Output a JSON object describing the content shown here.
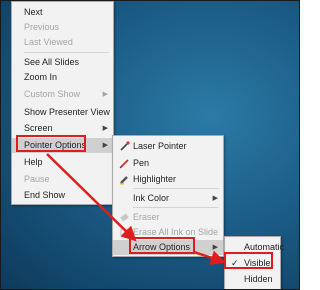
{
  "main_menu": {
    "items": [
      {
        "label": "Next"
      },
      {
        "label": "Previous"
      },
      {
        "label": "Last Viewed"
      },
      {
        "label": "See All Slides"
      },
      {
        "label": "Zoom In"
      },
      {
        "label": "Custom Show"
      },
      {
        "label": "Show Presenter View"
      },
      {
        "label": "Screen"
      },
      {
        "label": "Pointer Options"
      },
      {
        "label": "Help"
      },
      {
        "label": "Pause"
      },
      {
        "label": "End Show"
      }
    ]
  },
  "pointer_menu": {
    "items": [
      {
        "label": "Laser Pointer"
      },
      {
        "label": "Pen"
      },
      {
        "label": "Highlighter"
      },
      {
        "label": "Ink Color"
      },
      {
        "label": "Eraser"
      },
      {
        "label": "Erase All Ink on Slide"
      },
      {
        "label": "Arrow Options"
      }
    ]
  },
  "arrow_menu": {
    "items": [
      {
        "label": "Automatic"
      },
      {
        "label": "Visible",
        "checked": true
      },
      {
        "label": "Hidden"
      }
    ],
    "check_glyph": "✓"
  },
  "colors": {
    "highlight_box": "#e01d1d",
    "background": "#1b5d87"
  },
  "icons": {
    "submenu_arrow": "▶"
  }
}
